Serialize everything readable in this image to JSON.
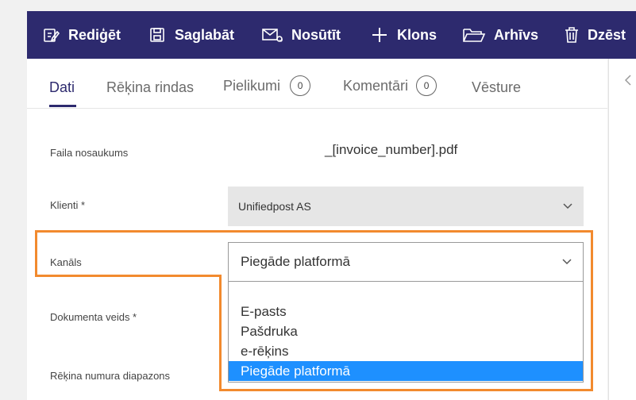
{
  "toolbar": {
    "buttons": [
      {
        "label": "Rediģēt",
        "icon": "edit-icon"
      },
      {
        "label": "Saglabāt",
        "icon": "save-icon"
      },
      {
        "label": "Nosūtīt",
        "icon": "send-mail-icon"
      },
      {
        "label": "Klons",
        "icon": "plus-icon"
      },
      {
        "label": "Arhīvs",
        "icon": "folder-icon"
      },
      {
        "label": "Dzēst",
        "icon": "trash-icon"
      }
    ]
  },
  "tabs": [
    {
      "label": "Dati",
      "active": true
    },
    {
      "label": "Rēķina rindas"
    },
    {
      "label": "Pielikumi",
      "count": "0"
    },
    {
      "label": "Komentāri",
      "count": "0"
    },
    {
      "label": "Vēsture"
    }
  ],
  "form": {
    "file_name_label": "Faila nosaukums",
    "file_name_value": "_[invoice_number].pdf",
    "client_label": "Klienti *",
    "client_value": "Unifiedpost AS",
    "channel_label": "Kanāls",
    "channel_value": "Piegāde platformā",
    "doc_type_label": "Dokumenta veids *",
    "range_label": "Rēķina numura diapazons"
  },
  "channel_options": [
    "E-pasts",
    "Pašdruka",
    "e-rēķins",
    "Piegāde platformā"
  ],
  "colors": {
    "toolbar": "#2d2a6e",
    "highlight": "#f28a2e",
    "selected_option": "#1e90ff"
  }
}
